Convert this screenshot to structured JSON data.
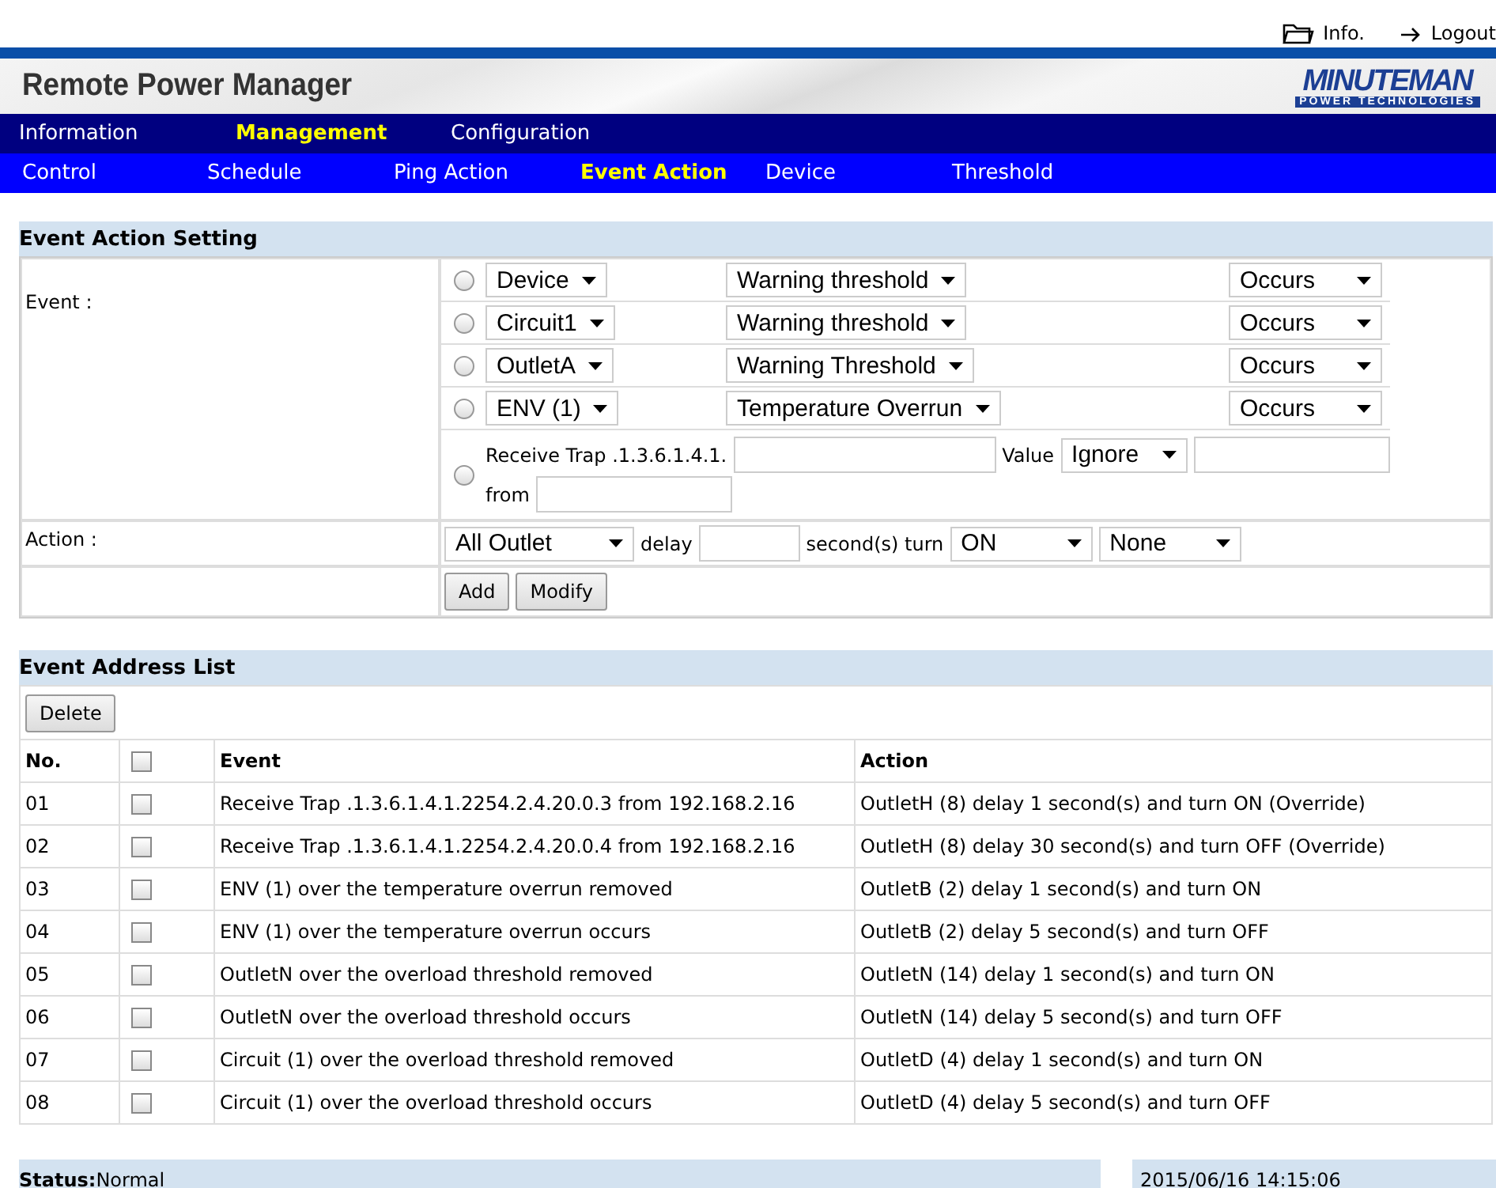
{
  "top_links": [
    {
      "kind": "info",
      "label": "Info."
    },
    {
      "kind": "logout",
      "label": "Logout"
    }
  ],
  "header": {
    "title": "Remote Power Manager",
    "logo": {
      "name": "MINUTEMAN",
      "tagline": "POWER TECHNOLOGIES"
    }
  },
  "main_nav": [
    {
      "label": "Information",
      "selected": false
    },
    {
      "label": "Management",
      "selected": true
    },
    {
      "label": "Configuration",
      "selected": false
    }
  ],
  "sub_nav": [
    {
      "label": "Control",
      "selected": false
    },
    {
      "label": "Schedule",
      "selected": false
    },
    {
      "label": "Ping Action",
      "selected": false
    },
    {
      "label": "Event Action",
      "selected": true
    },
    {
      "label": "Device",
      "selected": false
    },
    {
      "label": "Threshold",
      "selected": false
    }
  ],
  "event_action_setting": {
    "title": "Event Action Setting",
    "event_label": "Event :",
    "event_options": [
      {
        "selected": false,
        "source": "Device",
        "condition": "Warning threshold",
        "trigger": "Occurs"
      },
      {
        "selected": false,
        "source": "Circuit1",
        "condition": "Warning threshold",
        "trigger": "Occurs"
      },
      {
        "selected": false,
        "source": "OutletA",
        "condition": "Warning Threshold",
        "trigger": "Occurs"
      },
      {
        "selected": false,
        "source": "ENV (1)",
        "condition": "Temperature Overrun",
        "trigger": "Occurs"
      }
    ],
    "trap": {
      "selected": false,
      "prefix": "Receive Trap .1.3.6.1.4.1.",
      "value_label": "Value",
      "value_select": "Ignore",
      "from_label": "from"
    },
    "action_label": "Action :",
    "action": {
      "target": "All Outlet",
      "delay_label": "delay",
      "turn_label": "second(s) turn",
      "state": "ON",
      "option": "None"
    },
    "buttons": [
      "Add",
      "Modify"
    ]
  },
  "event_address_list": {
    "title": "Event Address List",
    "delete_button": "Delete",
    "columns": [
      "No.",
      "Event",
      "Action"
    ],
    "header_checked": false,
    "rows": [
      {
        "no": "01",
        "checked": false,
        "event": "Receive Trap .1.3.6.1.4.1.2254.2.4.20.0.3 from 192.168.2.16",
        "action": "OutletH (8) delay 1 second(s) and turn ON (Override)"
      },
      {
        "no": "02",
        "checked": false,
        "event": "Receive Trap .1.3.6.1.4.1.2254.2.4.20.0.4 from 192.168.2.16",
        "action": "OutletH (8) delay 30 second(s) and turn OFF (Override)"
      },
      {
        "no": "03",
        "checked": false,
        "event": "ENV (1) over the temperature overrun removed",
        "action": "OutletB (2) delay 1 second(s) and turn ON"
      },
      {
        "no": "04",
        "checked": false,
        "event": "ENV (1) over the temperature overrun occurs",
        "action": "OutletB (2) delay 5 second(s) and turn OFF"
      },
      {
        "no": "05",
        "checked": false,
        "event": "OutletN over the overload threshold removed",
        "action": "OutletN (14) delay 1 second(s) and turn ON"
      },
      {
        "no": "06",
        "checked": false,
        "event": "OutletN over the overload threshold occurs",
        "action": "OutletN (14) delay 5 second(s) and turn OFF"
      },
      {
        "no": "07",
        "checked": false,
        "event": "Circuit (1) over the overload threshold removed",
        "action": "OutletD (4) delay 1 second(s) and turn ON"
      },
      {
        "no": "08",
        "checked": false,
        "event": "Circuit (1) over the overload threshold occurs",
        "action": "OutletD (4) delay 5 second(s) and turn OFF"
      }
    ]
  },
  "status_bar": {
    "label": "Status:",
    "value": "Normal",
    "datetime": "2015/06/16 14:15:06"
  }
}
